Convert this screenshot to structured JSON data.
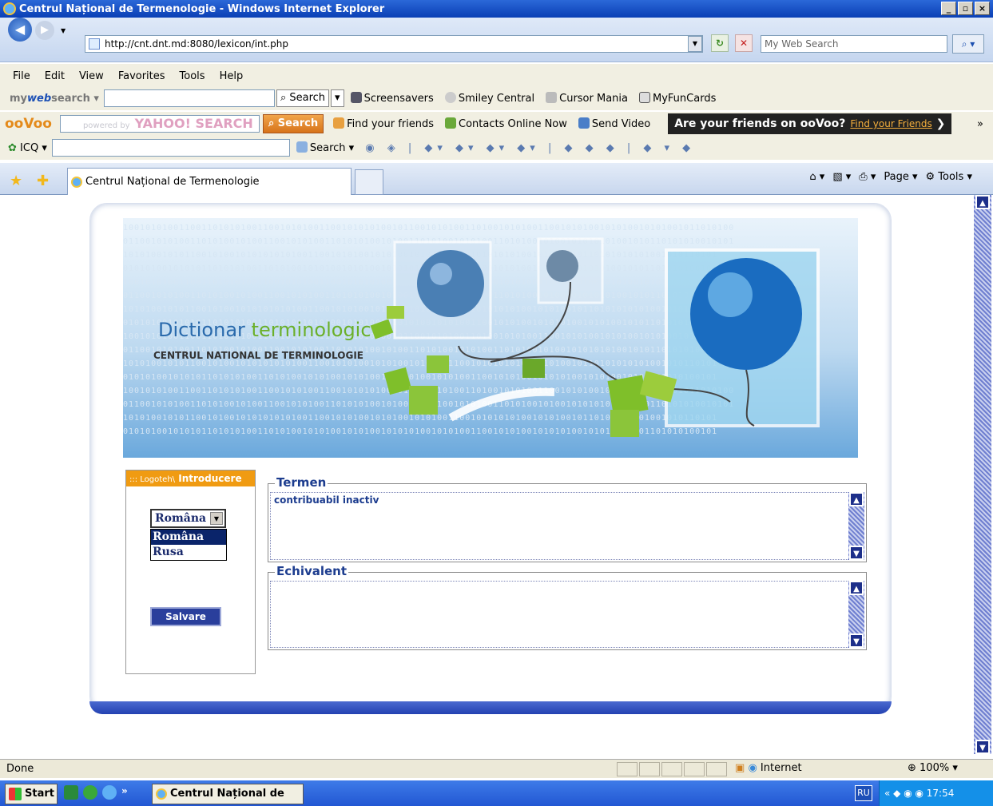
{
  "window": {
    "title": "Centrul Național de Termenologie - Windows Internet Explorer",
    "min_glyph": "_",
    "max_glyph": "▫",
    "close_glyph": "×"
  },
  "address_bar": {
    "url": "http://cnt.dnt.md:8080/lexicon/int.php",
    "search_placeholder": "My Web Search"
  },
  "menu": [
    "File",
    "Edit",
    "View",
    "Favorites",
    "Tools",
    "Help"
  ],
  "toolbar1": {
    "brand_plain": "my",
    "brand_bold": "web",
    "brand_tail": "search",
    "search_label": "Search",
    "items": [
      "Screensavers",
      "Smiley Central",
      "Cursor Mania",
      "MyFunCards"
    ]
  },
  "toolbar2": {
    "brand": "ooVoo",
    "powered_by": "powered by",
    "yahoo": "YAHOO! SEARCH",
    "search_label": "Search",
    "items": [
      "Find your friends",
      "Contacts Online Now",
      "Send Video"
    ],
    "banner_text": "Are your friends on ooVoo?",
    "banner_link": "Find your Friends"
  },
  "toolbar3": {
    "brand": "ICQ",
    "search_label": "Search"
  },
  "tab": {
    "title": "Centrul Național de Termenologie"
  },
  "command_bar": {
    "page_label": "Page",
    "tools_label": "Tools"
  },
  "banner": {
    "title_part1": "Dictionar",
    "title_part2": "terminologic",
    "subtitle": "CENTRUL NATIONAL DE TERMINOLOGIE"
  },
  "left_panel": {
    "header_prefix": "::: Logoteh\\",
    "header_main": "Introducere",
    "selected_language": "Româna",
    "options": [
      "Româna",
      "Rusa"
    ],
    "save_label": "Salvare"
  },
  "termen": {
    "legend": "Termen",
    "value": "contribuabil inactiv"
  },
  "echivalent": {
    "legend": "Echivalent",
    "value": ""
  },
  "status": {
    "text": "Done",
    "zone": "Internet",
    "zoom": "100%"
  },
  "taskbar": {
    "start_label": "Start",
    "task_label": "Centrul Național de T...",
    "lang": "RU",
    "clock": "17:54"
  },
  "colors": {
    "accent_orange": "#f09b12",
    "field_text_blue": "#1d3d8f",
    "save_button": "#2a3f9c"
  }
}
